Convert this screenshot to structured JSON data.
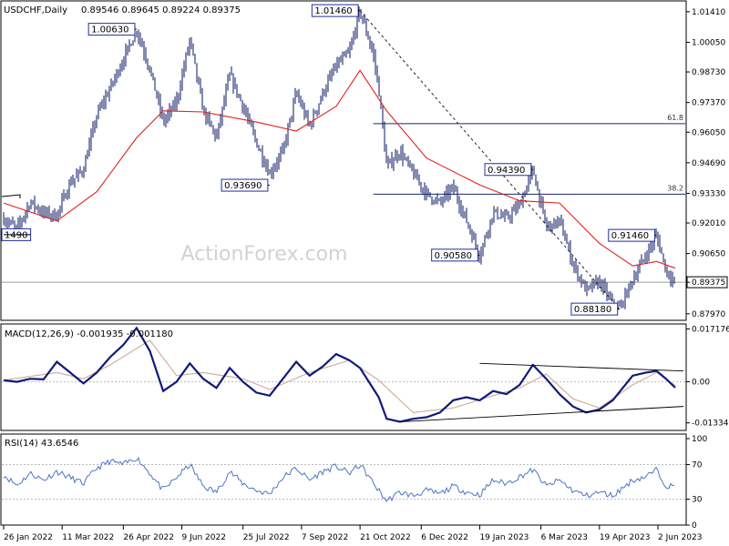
{
  "main_header": {
    "symbol": "USDCHF,Daily",
    "ohlc": "0.89546 0.89645 0.89224 0.89375"
  },
  "watermark": "ActionForex.com",
  "price_axis_labels": [
    "1.01410",
    "1.00050",
    "0.98730",
    "0.97370",
    "0.96050",
    "0.94690",
    "0.93330",
    "0.92010",
    "0.90650",
    "0.89375",
    "0.87970"
  ],
  "macd_header": "MACD(12,26,9) -0.001935 -0.001180",
  "macd_axis_labels": [
    "0.017176",
    "0.00",
    "-0.01334"
  ],
  "rsi_header": "RSI(14) 43.6546",
  "rsi_axis_labels": [
    "100",
    "70",
    "30",
    "0"
  ],
  "date_labels": [
    "26 Jan 2022",
    "11 Mar 2022",
    "26 Apr 2022",
    "9 Jun 2022",
    "25 Jul 2022",
    "7 Sep 2022",
    "21 Oct 2022",
    "6 Dec 2022",
    "19 Jan 2023",
    "6 Mar 2023",
    "19 Apr 2023",
    "2 Jun 2023"
  ],
  "colors": {
    "price_bars": "#0a1560",
    "moving_average": "#e02020",
    "macd_line": "#101a7a",
    "macd_signal": "#d0b0a0",
    "rsi_line": "#4a74c8",
    "grid_dotted": "#bbbbbb",
    "label_box_border": "#1e2e9e"
  },
  "chart_data": {
    "type": "ohlc",
    "symbol": "USDCHF",
    "timeframe": "Daily",
    "last": {
      "open": 0.89546,
      "high": 0.89645,
      "low": 0.89224,
      "close": 0.89375
    },
    "price_range": [
      0.8772,
      1.0185
    ],
    "price_points": [
      {
        "date": "2022-01-26",
        "price": 0.922
      },
      {
        "date": "2022-02-05",
        "price": 0.9175
      },
      {
        "date": "2022-02-15",
        "price": 0.9295
      },
      {
        "date": "2022-02-25",
        "price": 0.9245
      },
      {
        "date": "2022-03-07",
        "price": 0.9235
      },
      {
        "date": "2022-03-17",
        "price": 0.938
      },
      {
        "date": "2022-03-27",
        "price": 0.944
      },
      {
        "date": "2022-04-06",
        "price": 0.968
      },
      {
        "date": "2022-04-16",
        "price": 0.98
      },
      {
        "date": "2022-04-26",
        "price": 0.993
      },
      {
        "date": "2022-05-06",
        "price": 1.0063
      },
      {
        "date": "2022-05-16",
        "price": 0.9885
      },
      {
        "date": "2022-05-26",
        "price": 0.965
      },
      {
        "date": "2022-06-05",
        "price": 0.974
      },
      {
        "date": "2022-06-15",
        "price": 1.002
      },
      {
        "date": "2022-06-25",
        "price": 0.97
      },
      {
        "date": "2022-07-05",
        "price": 0.958
      },
      {
        "date": "2022-07-15",
        "price": 0.986
      },
      {
        "date": "2022-07-25",
        "price": 0.972
      },
      {
        "date": "2022-08-04",
        "price": 0.956
      },
      {
        "date": "2022-08-14",
        "price": 0.942
      },
      {
        "date": "2022-08-24",
        "price": 0.952
      },
      {
        "date": "2022-09-03",
        "price": 0.978
      },
      {
        "date": "2022-09-13",
        "price": 0.963
      },
      {
        "date": "2022-09-23",
        "price": 0.978
      },
      {
        "date": "2022-10-03",
        "price": 0.99
      },
      {
        "date": "2022-10-13",
        "price": 0.996
      },
      {
        "date": "2022-10-21",
        "price": 1.0146
      },
      {
        "date": "2022-10-31",
        "price": 0.995
      },
      {
        "date": "2022-11-04",
        "price": 0.98
      },
      {
        "date": "2022-11-10",
        "price": 0.945
      },
      {
        "date": "2022-11-20",
        "price": 0.952
      },
      {
        "date": "2022-11-30",
        "price": 0.942
      },
      {
        "date": "2022-12-10",
        "price": 0.933
      },
      {
        "date": "2022-12-20",
        "price": 0.929
      },
      {
        "date": "2022-12-30",
        "price": 0.936
      },
      {
        "date": "2023-01-09",
        "price": 0.921
      },
      {
        "date": "2023-01-19",
        "price": 0.9058
      },
      {
        "date": "2023-01-29",
        "price": 0.925
      },
      {
        "date": "2023-02-08",
        "price": 0.922
      },
      {
        "date": "2023-02-18",
        "price": 0.928
      },
      {
        "date": "2023-02-28",
        "price": 0.9439
      },
      {
        "date": "2023-03-10",
        "price": 0.918
      },
      {
        "date": "2023-03-20",
        "price": 0.921
      },
      {
        "date": "2023-03-30",
        "price": 0.902
      },
      {
        "date": "2023-04-09",
        "price": 0.89
      },
      {
        "date": "2023-04-19",
        "price": 0.894
      },
      {
        "date": "2023-04-29",
        "price": 0.884
      },
      {
        "date": "2023-05-04",
        "price": 0.8818
      },
      {
        "date": "2023-05-14",
        "price": 0.895
      },
      {
        "date": "2023-05-24",
        "price": 0.906
      },
      {
        "date": "2023-06-01",
        "price": 0.9146
      },
      {
        "date": "2023-06-08",
        "price": 0.899
      },
      {
        "date": "2023-06-15",
        "price": 0.8937
      }
    ],
    "moving_average": [
      {
        "date": "2022-01-26",
        "price": 0.929
      },
      {
        "date": "2022-03-07",
        "price": 0.921
      },
      {
        "date": "2022-04-06",
        "price": 0.934
      },
      {
        "date": "2022-05-06",
        "price": 0.958
      },
      {
        "date": "2022-05-26",
        "price": 0.97
      },
      {
        "date": "2022-06-25",
        "price": 0.9695
      },
      {
        "date": "2022-08-04",
        "price": 0.965
      },
      {
        "date": "2022-09-03",
        "price": 0.961
      },
      {
        "date": "2022-10-03",
        "price": 0.972
      },
      {
        "date": "2022-10-21",
        "price": 0.988
      },
      {
        "date": "2022-11-10",
        "price": 0.97
      },
      {
        "date": "2022-12-10",
        "price": 0.949
      },
      {
        "date": "2023-01-19",
        "price": 0.937
      },
      {
        "date": "2023-02-18",
        "price": 0.93
      },
      {
        "date": "2023-03-20",
        "price": 0.929
      },
      {
        "date": "2023-04-19",
        "price": 0.911
      },
      {
        "date": "2023-05-14",
        "price": 0.901
      },
      {
        "date": "2023-06-01",
        "price": 0.903
      },
      {
        "date": "2023-06-15",
        "price": 0.9
      }
    ],
    "price_labels": [
      {
        "text": "1.00630",
        "date": "2022-05-06",
        "price": 1.0063,
        "side": "left"
      },
      {
        "text": "1.01460",
        "date": "2022-10-21",
        "price": 1.0146,
        "side": "left"
      },
      {
        "text": "0.93690",
        "date": "2022-08-14",
        "price": 0.9369,
        "side": "left"
      },
      {
        "text": "0.90580",
        "date": "2023-01-19",
        "price": 0.9058,
        "side": "left"
      },
      {
        "text": "0.94390",
        "date": "2023-02-28",
        "price": 0.9439,
        "side": "left"
      },
      {
        "text": "0.91460",
        "date": "2023-06-01",
        "price": 0.9146,
        "side": "left"
      },
      {
        "text": "0.88180",
        "date": "2023-05-04",
        "price": 0.8818,
        "side": "left"
      },
      {
        "text": "1490",
        "date": "2022-01-26",
        "price": 0.9149,
        "side": "right"
      }
    ],
    "fibonacci_levels": [
      {
        "label": "61.8",
        "price": 0.9643,
        "from": "2022-10-31"
      },
      {
        "label": "38.2",
        "price": 0.9329,
        "from": "2022-10-31"
      }
    ],
    "trendlines": [
      {
        "from": {
          "date": "2022-10-21",
          "price": 1.0146
        },
        "to": {
          "date": "2023-05-04",
          "price": 0.8818
        },
        "style": "dashed"
      }
    ],
    "horizontal_lines": [
      {
        "price": 0.89375,
        "label": "0.89375"
      }
    ],
    "macd": {
      "params": "12,26,9",
      "value": -0.001935,
      "signal_value": -0.00118,
      "range": [
        -0.0155,
        0.0185
      ],
      "line": [
        {
          "date": "2022-01-26",
          "value": 0.0005
        },
        {
          "date": "2022-02-05",
          "value": 0.0
        },
        {
          "date": "2022-02-15",
          "value": 0.001
        },
        {
          "date": "2022-02-25",
          "value": 0.0008
        },
        {
          "date": "2022-03-07",
          "value": 0.0065
        },
        {
          "date": "2022-03-17",
          "value": 0.003
        },
        {
          "date": "2022-03-27",
          "value": -0.0005
        },
        {
          "date": "2022-04-06",
          "value": 0.003
        },
        {
          "date": "2022-04-16",
          "value": 0.008
        },
        {
          "date": "2022-04-26",
          "value": 0.012
        },
        {
          "date": "2022-05-06",
          "value": 0.0175
        },
        {
          "date": "2022-05-16",
          "value": 0.01
        },
        {
          "date": "2022-05-26",
          "value": -0.003
        },
        {
          "date": "2022-06-05",
          "value": 0.0
        },
        {
          "date": "2022-06-15",
          "value": 0.006
        },
        {
          "date": "2022-06-25",
          "value": 0.001
        },
        {
          "date": "2022-07-05",
          "value": -0.002
        },
        {
          "date": "2022-07-15",
          "value": 0.0045
        },
        {
          "date": "2022-07-25",
          "value": 0.0
        },
        {
          "date": "2022-08-04",
          "value": -0.0035
        },
        {
          "date": "2022-08-14",
          "value": -0.0045
        },
        {
          "date": "2022-08-24",
          "value": 0.001
        },
        {
          "date": "2022-09-03",
          "value": 0.0065
        },
        {
          "date": "2022-09-13",
          "value": 0.002
        },
        {
          "date": "2022-09-23",
          "value": 0.005
        },
        {
          "date": "2022-10-03",
          "value": 0.009
        },
        {
          "date": "2022-10-13",
          "value": 0.007
        },
        {
          "date": "2022-10-21",
          "value": 0.0045
        },
        {
          "date": "2022-11-04",
          "value": -0.005
        },
        {
          "date": "2022-11-10",
          "value": -0.012
        },
        {
          "date": "2022-11-20",
          "value": -0.013
        },
        {
          "date": "2022-11-30",
          "value": -0.012
        },
        {
          "date": "2022-12-10",
          "value": -0.0115
        },
        {
          "date": "2022-12-20",
          "value": -0.01
        },
        {
          "date": "2022-12-30",
          "value": -0.006
        },
        {
          "date": "2023-01-09",
          "value": -0.005
        },
        {
          "date": "2023-01-19",
          "value": -0.006
        },
        {
          "date": "2023-01-29",
          "value": -0.003
        },
        {
          "date": "2023-02-08",
          "value": -0.004
        },
        {
          "date": "2023-02-18",
          "value": -0.001
        },
        {
          "date": "2023-02-28",
          "value": 0.0055
        },
        {
          "date": "2023-03-10",
          "value": 0.001
        },
        {
          "date": "2023-03-20",
          "value": -0.004
        },
        {
          "date": "2023-03-30",
          "value": -0.008
        },
        {
          "date": "2023-04-09",
          "value": -0.01
        },
        {
          "date": "2023-04-19",
          "value": -0.009
        },
        {
          "date": "2023-04-29",
          "value": -0.006
        },
        {
          "date": "2023-05-14",
          "value": 0.002
        },
        {
          "date": "2023-05-24",
          "value": 0.003
        },
        {
          "date": "2023-06-01",
          "value": 0.0035
        },
        {
          "date": "2023-06-08",
          "value": 0.001
        },
        {
          "date": "2023-06-15",
          "value": -0.0019
        }
      ],
      "signal": [
        {
          "date": "2022-01-26",
          "value": 0.0005
        },
        {
          "date": "2022-03-07",
          "value": 0.003
        },
        {
          "date": "2022-03-27",
          "value": 0.001
        },
        {
          "date": "2022-04-16",
          "value": 0.0055
        },
        {
          "date": "2022-05-16",
          "value": 0.0135
        },
        {
          "date": "2022-06-05",
          "value": 0.002
        },
        {
          "date": "2022-06-25",
          "value": 0.003
        },
        {
          "date": "2022-07-25",
          "value": 0.001
        },
        {
          "date": "2022-08-14",
          "value": -0.0025
        },
        {
          "date": "2022-09-13",
          "value": 0.003
        },
        {
          "date": "2022-10-13",
          "value": 0.007
        },
        {
          "date": "2022-11-04",
          "value": 0.0005
        },
        {
          "date": "2022-11-30",
          "value": -0.01
        },
        {
          "date": "2022-12-30",
          "value": -0.0085
        },
        {
          "date": "2023-01-29",
          "value": -0.0045
        },
        {
          "date": "2023-02-18",
          "value": -0.002
        },
        {
          "date": "2023-03-10",
          "value": 0.0025
        },
        {
          "date": "2023-03-30",
          "value": -0.0055
        },
        {
          "date": "2023-04-19",
          "value": -0.0085
        },
        {
          "date": "2023-05-14",
          "value": -0.001
        },
        {
          "date": "2023-06-01",
          "value": 0.003
        },
        {
          "date": "2023-06-15",
          "value": -0.0012
        }
      ],
      "trendlines": [
        {
          "from": {
            "date": "2023-01-19",
            "value": 0.006
          },
          "to": {
            "date": "2023-06-15",
            "value": 0.0035
          }
        },
        {
          "from": {
            "date": "2022-11-20",
            "value": -0.013
          },
          "to": {
            "date": "2023-06-15",
            "value": -0.008
          }
        }
      ]
    },
    "rsi": {
      "period": 14,
      "value": 43.6546,
      "range": [
        0,
        100
      ],
      "levels": [
        70,
        30
      ],
      "line": [
        {
          "date": "2022-01-26",
          "value": 58
        },
        {
          "date": "2022-02-05",
          "value": 46
        },
        {
          "date": "2022-02-15",
          "value": 60
        },
        {
          "date": "2022-02-25",
          "value": 52
        },
        {
          "date": "2022-03-07",
          "value": 62
        },
        {
          "date": "2022-03-17",
          "value": 55
        },
        {
          "date": "2022-03-27",
          "value": 48
        },
        {
          "date": "2022-04-06",
          "value": 66
        },
        {
          "date": "2022-04-16",
          "value": 74
        },
        {
          "date": "2022-04-26",
          "value": 70
        },
        {
          "date": "2022-05-06",
          "value": 78
        },
        {
          "date": "2022-05-16",
          "value": 60
        },
        {
          "date": "2022-05-26",
          "value": 40
        },
        {
          "date": "2022-06-05",
          "value": 55
        },
        {
          "date": "2022-06-15",
          "value": 70
        },
        {
          "date": "2022-06-25",
          "value": 45
        },
        {
          "date": "2022-07-05",
          "value": 38
        },
        {
          "date": "2022-07-15",
          "value": 62
        },
        {
          "date": "2022-07-25",
          "value": 48
        },
        {
          "date": "2022-08-04",
          "value": 40
        },
        {
          "date": "2022-08-14",
          "value": 36
        },
        {
          "date": "2022-08-24",
          "value": 55
        },
        {
          "date": "2022-09-03",
          "value": 66
        },
        {
          "date": "2022-09-13",
          "value": 52
        },
        {
          "date": "2022-09-23",
          "value": 62
        },
        {
          "date": "2022-10-03",
          "value": 68
        },
        {
          "date": "2022-10-13",
          "value": 60
        },
        {
          "date": "2022-10-21",
          "value": 70
        },
        {
          "date": "2022-11-04",
          "value": 40
        },
        {
          "date": "2022-11-10",
          "value": 28
        },
        {
          "date": "2022-11-20",
          "value": 38
        },
        {
          "date": "2022-11-30",
          "value": 34
        },
        {
          "date": "2022-12-10",
          "value": 40
        },
        {
          "date": "2022-12-20",
          "value": 36
        },
        {
          "date": "2022-12-30",
          "value": 45
        },
        {
          "date": "2023-01-09",
          "value": 38
        },
        {
          "date": "2023-01-19",
          "value": 35
        },
        {
          "date": "2023-01-29",
          "value": 52
        },
        {
          "date": "2023-02-08",
          "value": 48
        },
        {
          "date": "2023-02-18",
          "value": 56
        },
        {
          "date": "2023-02-28",
          "value": 64
        },
        {
          "date": "2023-03-10",
          "value": 45
        },
        {
          "date": "2023-03-20",
          "value": 52
        },
        {
          "date": "2023-03-30",
          "value": 40
        },
        {
          "date": "2023-04-09",
          "value": 34
        },
        {
          "date": "2023-04-19",
          "value": 38
        },
        {
          "date": "2023-04-29",
          "value": 34
        },
        {
          "date": "2023-05-14",
          "value": 52
        },
        {
          "date": "2023-05-24",
          "value": 56
        },
        {
          "date": "2023-06-01",
          "value": 64
        },
        {
          "date": "2023-06-08",
          "value": 46
        },
        {
          "date": "2023-06-15",
          "value": 44
        }
      ]
    }
  }
}
